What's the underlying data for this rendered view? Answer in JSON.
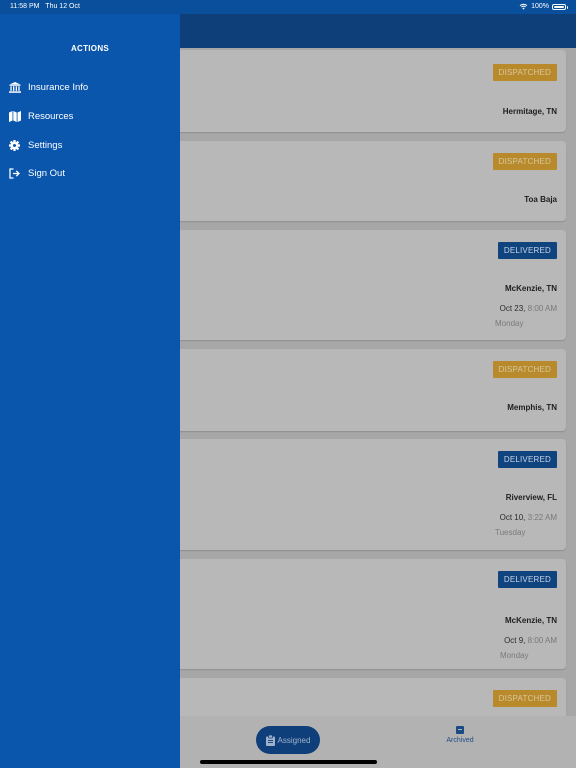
{
  "status": {
    "time": "11:58 PM",
    "date": "Thu 12 Oct",
    "battery": "100%"
  },
  "drawer": {
    "title": "ACTIONS",
    "items": [
      {
        "label": "Insurance Info",
        "icon": "bank-icon"
      },
      {
        "label": "Resources",
        "icon": "map-icon"
      },
      {
        "label": "Settings",
        "icon": "gear-icon"
      },
      {
        "label": "Sign Out",
        "icon": "sign-out-icon"
      }
    ]
  },
  "cards": [
    {
      "status": "DISPATCHED",
      "city": "Hermitage, TN"
    },
    {
      "status": "DISPATCHED",
      "city": "Toa Baja"
    },
    {
      "status": "DELIVERED",
      "city": "McKenzie, TN",
      "date": "Oct 23,",
      "time": "8:00 AM",
      "day": "Monday"
    },
    {
      "status": "DISPATCHED",
      "city": "Memphis, TN"
    },
    {
      "status": "DELIVERED",
      "city": "Riverview, FL",
      "date": "Oct 10,",
      "time": "3:22 AM",
      "day": "Tuesday"
    },
    {
      "status": "DELIVERED",
      "city": "McKenzie, TN",
      "date": "Oct 9,",
      "time": "8:00 AM",
      "day": "Monday"
    },
    {
      "status": "DISPATCHED"
    }
  ],
  "tabs": {
    "assigned": "Assigned",
    "archived": "Archived"
  },
  "colors": {
    "drawer": "#0a56ad",
    "dispatched": "#b98a2b",
    "delivered": "#10447f"
  }
}
